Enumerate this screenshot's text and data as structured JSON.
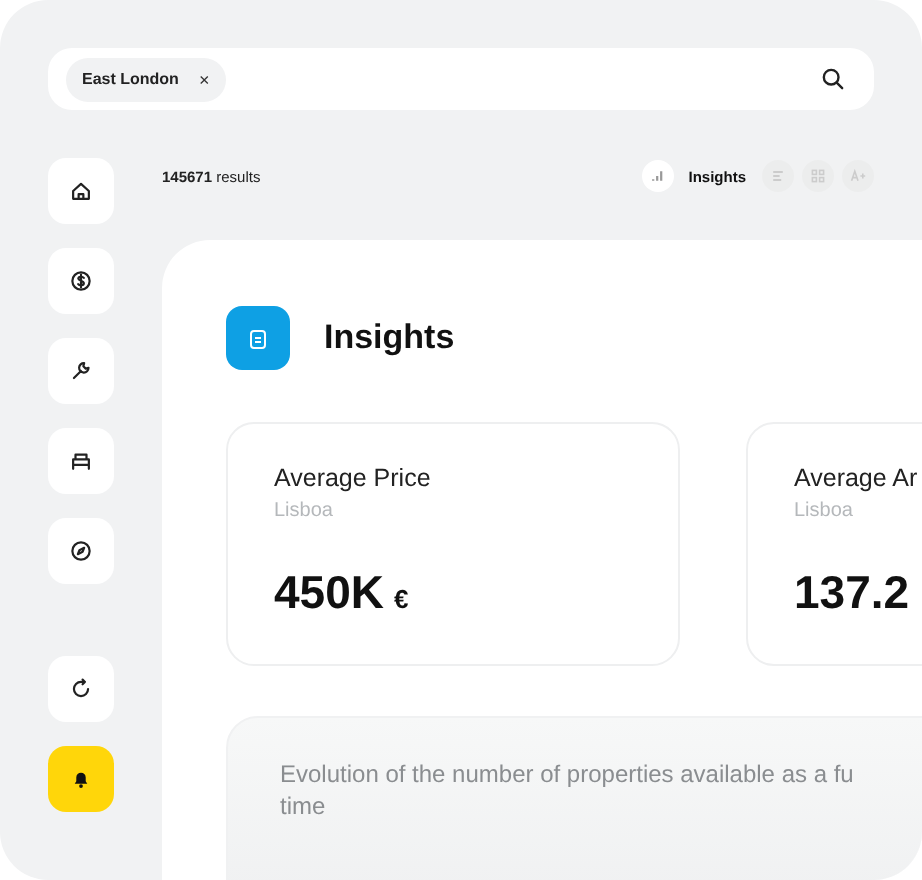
{
  "search": {
    "chips": [
      {
        "label": "East London",
        "remove": "×"
      }
    ]
  },
  "sidebar": {
    "items": [
      {
        "highlighted": false
      },
      {
        "highlighted": false
      },
      {
        "highlighted": false
      },
      {
        "highlighted": false
      },
      {
        "highlighted": false
      },
      {
        "highlighted": false
      },
      {
        "highlighted": true
      }
    ]
  },
  "results": {
    "count": "145671",
    "suffix": "results"
  },
  "views": [
    {
      "label": "Insights",
      "selected": true
    },
    {
      "selected": false
    },
    {
      "selected": false
    },
    {
      "selected": false
    }
  ],
  "panel": {
    "title": "Insights",
    "cards": [
      {
        "title": "Average Price",
        "subtitle": "Lisboa",
        "value": "450K",
        "unit": "€"
      },
      {
        "title": "Average Ar",
        "subtitle": "Lisboa",
        "value": "137.2"
      }
    ],
    "chart_card": {
      "lines": [
        "Evolution of the number of properties available as a fu",
        "time"
      ]
    }
  }
}
